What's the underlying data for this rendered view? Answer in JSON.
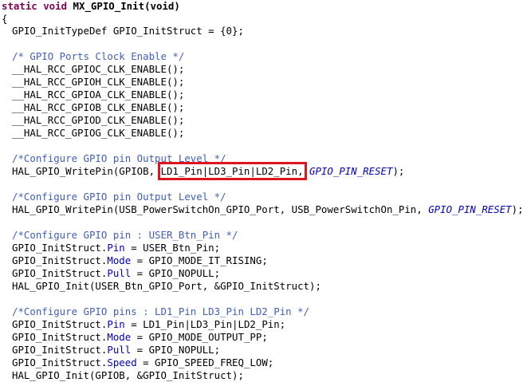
{
  "code": {
    "l1": {
      "kw": "static void",
      "fn": "MX_GPIO_Init",
      "rest": "(void)"
    },
    "l2": "{",
    "l3": "GPIO_InitTypeDef GPIO_InitStruct = {0};",
    "l5": "/* GPIO Ports Clock Enable */",
    "l6": "__HAL_RCC_GPIOC_CLK_ENABLE();",
    "l7": "__HAL_RCC_GPIOH_CLK_ENABLE();",
    "l8": "__HAL_RCC_GPIOA_CLK_ENABLE();",
    "l9": "__HAL_RCC_GPIOB_CLK_ENABLE();",
    "l10": "__HAL_RCC_GPIOD_CLK_ENABLE();",
    "l11": "__HAL_RCC_GPIOG_CLK_ENABLE();",
    "l13": "/*Configure GPIO pin Output Level */",
    "l14": {
      "pre": "HAL_GPIO_WritePin(GPIOB, ",
      "highlight": "LD1_Pin|LD3_Pin|LD2_Pin,",
      "const": "GPIO_PIN_RESET",
      "post": ");"
    },
    "l16": "/*Configure GPIO pin Output Level */",
    "l17": {
      "pre": "HAL_GPIO_WritePin(USB_PowerSwitchOn_GPIO_Port, USB_PowerSwitchOn_Pin, ",
      "const": "GPIO_PIN_RESET",
      "post": ");"
    },
    "l19": "/*Configure GPIO pin : USER_Btn_Pin */",
    "l20": {
      "obj": "GPIO_InitStruct.",
      "field": "Pin",
      "val": " = USER_Btn_Pin;"
    },
    "l21": {
      "obj": "GPIO_InitStruct.",
      "field": "Mode",
      "val": " = GPIO_MODE_IT_RISING;"
    },
    "l22": {
      "obj": "GPIO_InitStruct.",
      "field": "Pull",
      "val": " = GPIO_NOPULL;"
    },
    "l23": "HAL_GPIO_Init(USER_Btn_GPIO_Port, &GPIO_InitStruct);",
    "l25": "/*Configure GPIO pins : LD1_Pin LD3_Pin LD2_Pin */",
    "l26": {
      "obj": "GPIO_InitStruct.",
      "field": "Pin",
      "val": " = LD1_Pin|LD3_Pin|LD2_Pin;"
    },
    "l27": {
      "obj": "GPIO_InitStruct.",
      "field": "Mode",
      "val": " = GPIO_MODE_OUTPUT_PP;"
    },
    "l28": {
      "obj": "GPIO_InitStruct.",
      "field": "Pull",
      "val": " = GPIO_NOPULL;"
    },
    "l29": {
      "obj": "GPIO_InitStruct.",
      "field": "Speed",
      "val": " = GPIO_SPEED_FREQ_LOW;"
    },
    "l30": "HAL_GPIO_Init(GPIOB, &GPIO_InitStruct);"
  },
  "colors": {
    "keyword": "#7f0055",
    "comment": "#3f5fbf",
    "field": "#0000c0",
    "highlight_box": "#e0141e"
  }
}
